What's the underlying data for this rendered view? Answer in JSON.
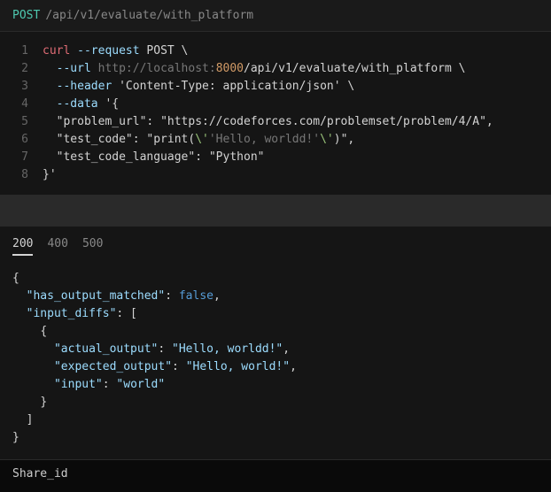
{
  "request": {
    "method": "POST",
    "path": "/api/v1/evaluate/with_platform"
  },
  "curl": {
    "command": "curl",
    "flag_request": "--request",
    "method_val": "POST",
    "flag_url": "--url",
    "url_prefix": "http://localhost:",
    "port": "8000",
    "url_suffix": "/api/v1/evaluate/with_platform",
    "flag_header": "--header",
    "header_val": "'Content-Type: application/json'",
    "flag_data": "--data",
    "data_open": "'{",
    "body_line1_key": "\"problem_url\"",
    "body_line1_val": "\"https://codeforces.com/problemset/problem/4/A\"",
    "body_line2_key": "\"test_code\"",
    "body_line2_val_pre": "\"print(",
    "body_line2_esc1": "\\'",
    "body_line2_mid": "'Hello, worldd!'",
    "body_line2_esc2": "\\'",
    "body_line2_val_post": ")\"",
    "body_line3_key": "\"test_code_language\"",
    "body_line3_val": "\"Python\"",
    "data_close": "}'",
    "backslash": " \\"
  },
  "line_nums": [
    "1",
    "2",
    "3",
    "4",
    "5",
    "6",
    "7",
    "8"
  ],
  "status": {
    "tabs": [
      "200",
      "400",
      "500"
    ],
    "active": "200"
  },
  "response": {
    "open_brace": "{",
    "line1_key": "\"has_output_matched\"",
    "line1_val": "false",
    "line2_key": "\"input_diffs\"",
    "inner_open": "{",
    "diff_key1": "\"actual_output\"",
    "diff_val1": "\"Hello, worldd!\"",
    "diff_key2": "\"expected_output\"",
    "diff_val2": "\"Hello, world!\"",
    "diff_key3": "\"input\"",
    "diff_val3": "\"world\"",
    "inner_close": "}",
    "array_close": "]",
    "close_brace": "}"
  },
  "footer": {
    "label": "Share_id"
  }
}
